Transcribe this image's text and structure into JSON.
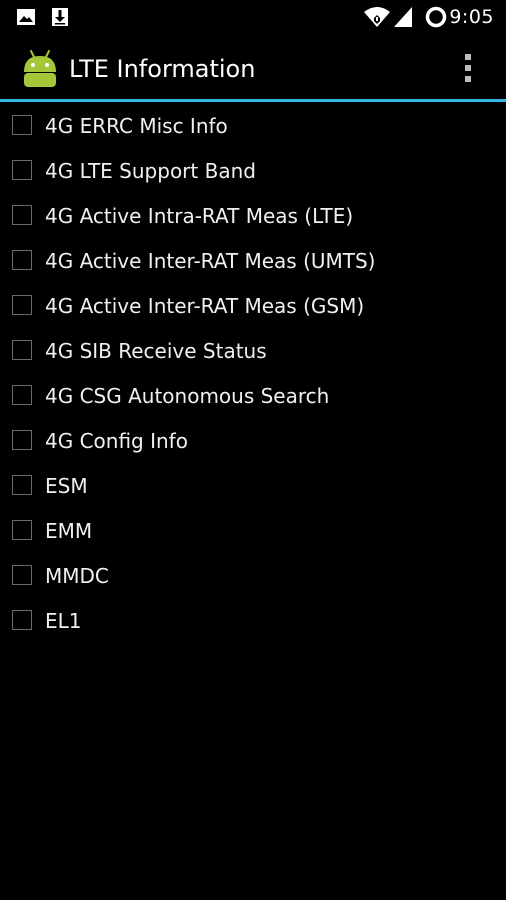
{
  "status_bar": {
    "time": "9:05",
    "left_icons": [
      "image-icon",
      "download-icon"
    ],
    "right_icons": [
      "wifi-icon",
      "cell-signal-icon",
      "sync-icon"
    ]
  },
  "action_bar": {
    "title": "LTE Information",
    "app_icon": "android-icon",
    "overflow_icon": "overflow-menu-icon",
    "accent_color": "#33b5e5"
  },
  "items": [
    {
      "label": "4G ERRC Misc Info",
      "checked": false
    },
    {
      "label": "4G LTE Support Band",
      "checked": false
    },
    {
      "label": "4G Active Intra-RAT Meas (LTE)",
      "checked": false
    },
    {
      "label": "4G Active Inter-RAT Meas (UMTS)",
      "checked": false
    },
    {
      "label": "4G Active Inter-RAT Meas (GSM)",
      "checked": false
    },
    {
      "label": "4G SIB Receive Status",
      "checked": false
    },
    {
      "label": "4G CSG Autonomous Search",
      "checked": false
    },
    {
      "label": "4G Config Info",
      "checked": false
    },
    {
      "label": "ESM",
      "checked": false
    },
    {
      "label": "EMM",
      "checked": false
    },
    {
      "label": "MMDC",
      "checked": false
    },
    {
      "label": "EL1",
      "checked": false
    }
  ]
}
